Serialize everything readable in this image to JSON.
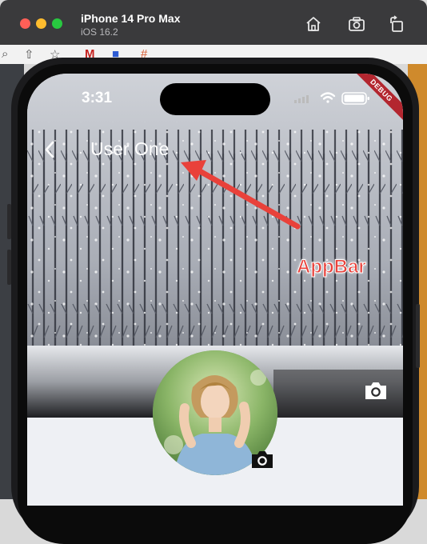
{
  "simulator": {
    "device_name": "iPhone 14 Pro Max",
    "os_version": "iOS 16.2",
    "icons": [
      "home-icon",
      "screenshot-icon",
      "rotate-icon"
    ]
  },
  "status_bar": {
    "time": "3:31",
    "icons": [
      "cellular-icon",
      "wifi-icon",
      "battery-icon"
    ]
  },
  "debug_banner": "DEBUG",
  "app_bar": {
    "back_icon": "chevron-left-icon",
    "title": "User One"
  },
  "profile": {
    "cover_camera_icon": "camera-icon",
    "avatar_camera_icon": "camera-icon"
  },
  "annotation": {
    "label": "AppBar",
    "color": "#e9413a"
  }
}
